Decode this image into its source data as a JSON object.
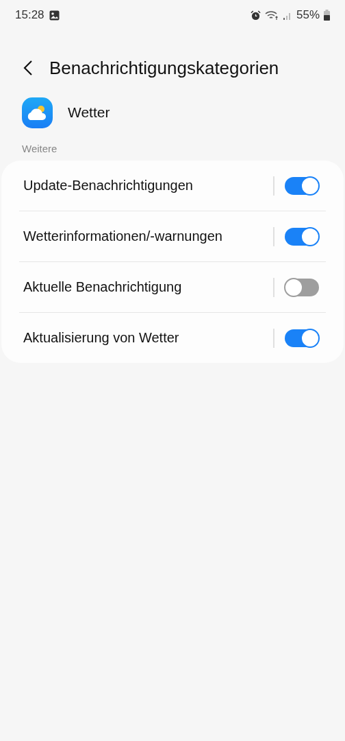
{
  "status_bar": {
    "time": "15:28",
    "battery": "55%"
  },
  "header": {
    "title": "Benachrichtigungskategorien"
  },
  "app": {
    "name": "Wetter"
  },
  "section": {
    "label": "Weitere"
  },
  "settings": [
    {
      "label": "Update-Benachrichtigungen",
      "on": true
    },
    {
      "label": "Wetterinformationen/-warnungen",
      "on": true
    },
    {
      "label": "Aktuelle Benachrichtigung",
      "on": false
    },
    {
      "label": "Aktualisierung von Wetter",
      "on": true
    }
  ]
}
